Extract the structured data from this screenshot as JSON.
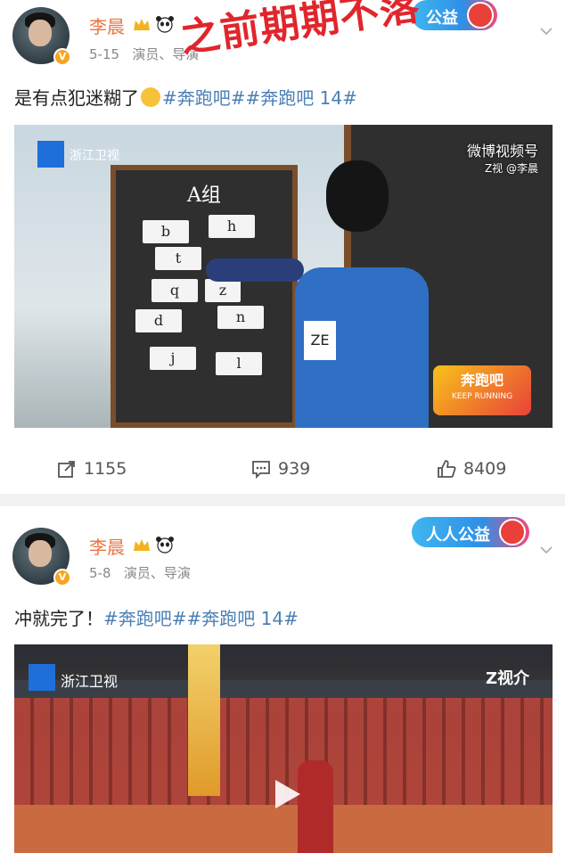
{
  "overlay": {
    "text": "之前期期不落"
  },
  "posts": [
    {
      "username": "李晨",
      "date": "5-15",
      "roles": "演员、导演",
      "badge_text": "公益",
      "text_plain": "是有点犯迷糊了",
      "tags": "#奔跑吧##奔跑吧 14#",
      "video": {
        "board_title": "A组",
        "cards": [
          "b",
          "h",
          "t",
          "q",
          "z",
          "d",
          "n",
          "j",
          "l"
        ],
        "number": "ZE",
        "tv_logo": "浙江卫视",
        "watermark": "微博视频号",
        "watermark_sub": "Z视 @李晨",
        "show_logo": "奔跑吧",
        "show_logo_sub": "KEEP RUNNING"
      },
      "actions": {
        "repost": "1155",
        "comment": "939",
        "like": "8409"
      }
    },
    {
      "username": "李晨",
      "date": "5-8",
      "roles": "演员、导演",
      "badge_text": "人人公益",
      "text_plain": "冲就完了！",
      "tags": "#奔跑吧##奔跑吧 14#",
      "video": {
        "tv_logo": "浙江卫视",
        "corner": "Z视介"
      }
    }
  ],
  "colors": {
    "username": "#eb7340",
    "tag": "#4a7fb5",
    "overlay": "#e0262c",
    "vbadge": "#f5a623"
  },
  "icons": [
    "crown-icon",
    "panda-icon",
    "more-icon",
    "repost-icon",
    "comment-icon",
    "like-icon",
    "play-icon",
    "emoji-icon"
  ]
}
